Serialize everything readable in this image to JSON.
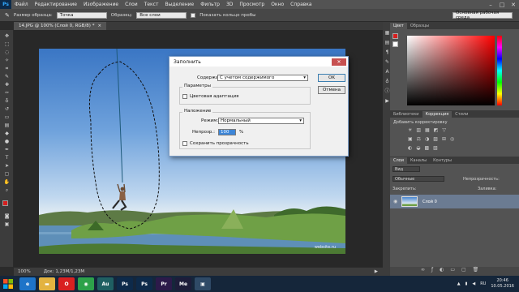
{
  "app": {
    "logo": "Ps"
  },
  "menu": [
    "Файл",
    "Редактирование",
    "Изображение",
    "Слои",
    "Текст",
    "Выделение",
    "Фильтр",
    "3D",
    "Просмотр",
    "Окно",
    "Справка"
  ],
  "window_controls": {
    "minimize": "–",
    "maximize": "□",
    "close": "✕"
  },
  "options": {
    "sample_size_label": "Размер образца:",
    "sample_size_value": "Точка",
    "samples_label": "Образец:",
    "samples_value": "Все слои",
    "show_ring_label": "Показать кольцо пробы",
    "workspace": "Основная рабочая среда"
  },
  "document": {
    "tab_title": "14.JPG @ 100% (Слой 0, RGB/8) *",
    "tab_close": "×"
  },
  "status": {
    "zoom": "100%",
    "doc_size": "Док: 1,23M/1,23M"
  },
  "dialog": {
    "title": "Заполнить",
    "close": "✕",
    "content_label": "Содержание:",
    "content_value": "С учетом содержимого",
    "ok": "OK",
    "cancel": "Отмена",
    "params_group": "Параметры",
    "color_adapt_label": "Цветовая адаптация",
    "blend_group": "Наложение",
    "mode_label": "Режим:",
    "mode_value": "Нормальный",
    "opacity_label": "Непрозр.:",
    "opacity_value": "100",
    "opacity_unit": "%",
    "preserve_label": "Сохранить прозрачность"
  },
  "panels": {
    "color_tabs": [
      "Цвет",
      "Образцы"
    ],
    "adj_tabs": [
      "Библиотеки",
      "Коррекция",
      "Стили"
    ],
    "adj_add": "Добавить корректировку",
    "layer_tabs": [
      "Слои",
      "Каналы",
      "Контуры"
    ],
    "kind_label": "Вид",
    "blend_mode": "Обычные",
    "opacity_label": "Непрозрачность:",
    "lock_label": "Закрепить:",
    "fill_label": "Заливка:",
    "layer_name": "Слой 0",
    "brand_color": "#d61f1f"
  },
  "watermark": "website.ru",
  "taskbar": {
    "apps": [
      {
        "name": "ie",
        "label": "e",
        "color": "#1e74c8"
      },
      {
        "name": "explorer",
        "label": "▬",
        "color": "#e3b340"
      },
      {
        "name": "opera",
        "label": "O",
        "color": "#d92020"
      },
      {
        "name": "chrome",
        "label": "◉",
        "color": "#2da24a"
      },
      {
        "name": "audition",
        "label": "Au",
        "color": "#1f5f62"
      },
      {
        "name": "photoshop-a",
        "label": "Ps",
        "color": "#0d2a4a"
      },
      {
        "name": "photoshop-b",
        "label": "Ps",
        "color": "#0d2a4a"
      },
      {
        "name": "premiere",
        "label": "Pr",
        "color": "#2c1a4a"
      },
      {
        "name": "media-encoder",
        "label": "Me",
        "color": "#1d1d3a"
      },
      {
        "name": "extra",
        "label": "▣",
        "color": "#2f4a66"
      }
    ],
    "lang": "RU",
    "time": "20:46",
    "date": "10.05.2016"
  }
}
